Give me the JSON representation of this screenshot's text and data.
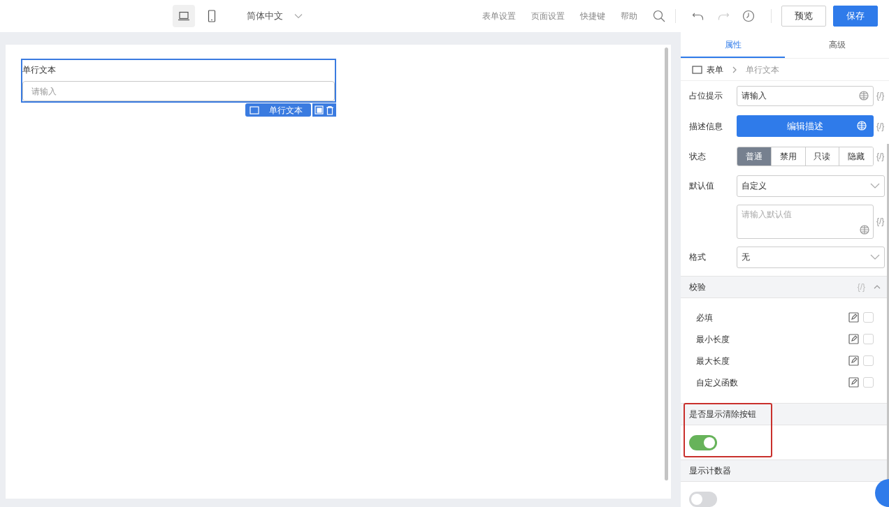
{
  "toolbar": {
    "devices": [
      {
        "kind": "desktop",
        "selected": true
      },
      {
        "kind": "mobile",
        "selected": false
      }
    ],
    "language": "简体中文",
    "links": [
      "表单设置",
      "页面设置",
      "快捷键",
      "帮助"
    ],
    "history": [
      {
        "kind": "undo",
        "disabled": false
      },
      {
        "kind": "redo",
        "disabled": true
      },
      {
        "kind": "history",
        "disabled": false
      }
    ],
    "buttons": [
      {
        "label": "预览",
        "kind": "secondary"
      },
      {
        "label": "保存",
        "kind": "primary"
      }
    ]
  },
  "canvas": {
    "field": {
      "label": "单行文本",
      "placeholder": "请输入",
      "selected": true,
      "tag": "单行文本"
    }
  },
  "panel": {
    "tabs": [
      {
        "label": "属性",
        "selected": true
      },
      {
        "label": "高级",
        "selected": false
      }
    ],
    "breadcrumb": [
      "表单",
      "单行文本"
    ],
    "properties": [
      {
        "kind": "input",
        "label": "占位提示",
        "value": "请输入",
        "expr": "{/}"
      },
      {
        "kind": "button",
        "label": "描述信息",
        "text": "编辑描述",
        "expr": "{/}"
      },
      {
        "kind": "segmented",
        "label": "状态",
        "options": [
          {
            "label": "普通",
            "selected": true
          },
          {
            "label": "禁用",
            "selected": false
          },
          {
            "label": "只读",
            "selected": false
          },
          {
            "label": "隐藏",
            "selected": false
          }
        ],
        "expr": "{/}"
      },
      {
        "kind": "select",
        "label": "默认值",
        "value": "自定义"
      },
      {
        "kind": "textarea",
        "placeholder": "请输入默认值",
        "expr": "{/}"
      },
      {
        "kind": "select",
        "label": "格式",
        "value": "无"
      }
    ],
    "validation": {
      "title": "校验",
      "expr": "{/}",
      "expanded": true,
      "rules": [
        {
          "label": "必填",
          "checked": false
        },
        {
          "label": "最小长度",
          "checked": false
        },
        {
          "label": "最大长度",
          "checked": false
        },
        {
          "label": "自定义函数",
          "checked": false
        }
      ]
    },
    "switches": [
      {
        "title": "是否显示清除按钮",
        "on": true,
        "highlighted": true
      },
      {
        "title": "显示计数器",
        "on": false,
        "highlighted": false
      }
    ]
  }
}
